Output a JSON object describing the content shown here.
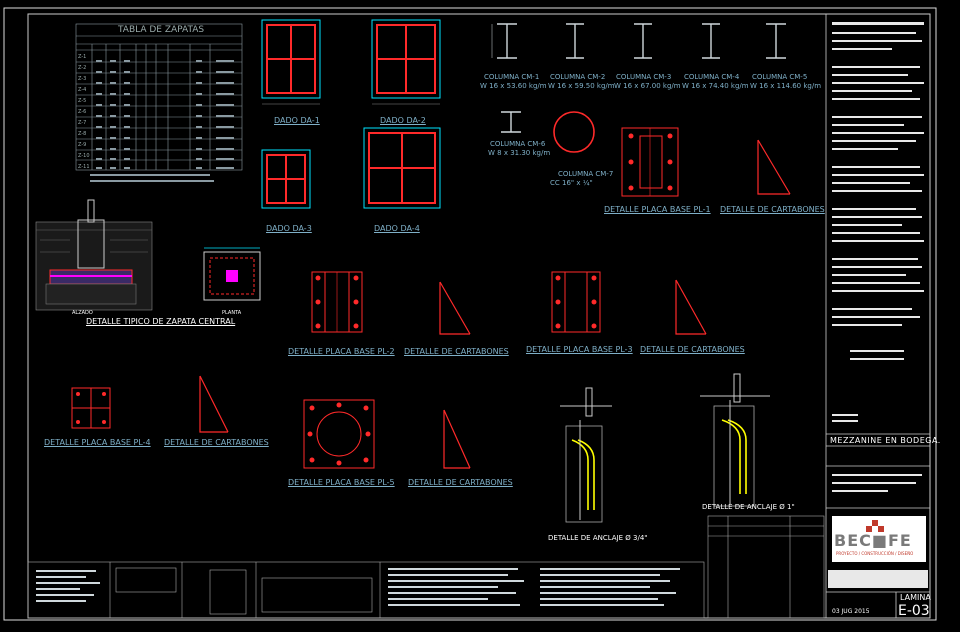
{
  "zapatas_table": {
    "title": "TABLA DE ZAPATAS",
    "rows": [
      "Z-1",
      "Z-2",
      "Z-3",
      "Z-4",
      "Z-5",
      "Z-6",
      "Z-7",
      "Z-8",
      "Z-9",
      "Z-10",
      "Z-11"
    ]
  },
  "dados": [
    "DADO DA-1",
    "DADO DA-2",
    "DADO DA-3",
    "DADO DA-4"
  ],
  "columnas": [
    "COLUMNA CM-1",
    "COLUMNA CM-2",
    "COLUMNA CM-3",
    "COLUMNA CM-4",
    "COLUMNA CM-5",
    "COLUMNA CM-6",
    "COLUMNA CM-7"
  ],
  "columnas_specs": [
    "W 16 x 53.60 kg/m",
    "W 16 x 59.50 kg/m",
    "W 16 x 67.00 kg/m",
    "W 16 x 74.40 kg/m",
    "W 16 x 114.60 kg/m",
    "W 8 x 31.30 kg/m",
    "CC 16\" x ¼\""
  ],
  "detalles": {
    "placa_pl1": "DETALLE PLACA BASE PL-1",
    "cartabones": "DETALLE DE CARTABONES",
    "zapata_central": "DETALLE TIPICO DE ZAPATA CENTRAL",
    "placa_pl2": "DETALLE PLACA BASE PL-2",
    "placa_pl3": "DETALLE PLACA BASE PL-3",
    "placa_pl4": "DETALLE PLACA BASE PL-4",
    "placa_pl5": "DETALLE PLACA BASE PL-5",
    "anclaje_34": "DETALLE DE ANCLAJE Ø 3/4\"",
    "anclaje_1": "DETALLE DE ANCLAJE Ø 1\""
  },
  "zapata_views": {
    "alzado": "ALZADO",
    "planta": "PLANTA"
  },
  "title_block": {
    "project": "MEZZANINE EN BODEGA.",
    "logo_name": "BEC■FE",
    "logo_sub": "PROYECTO / CONSTRUCCIÓN / DISEÑO",
    "lamina_label": "LAMINA",
    "lamina_code": "E-03",
    "date": "03 JUG 2015"
  },
  "colors": {
    "red": "#ff2a2a",
    "cyan": "#00e5ff",
    "yellow": "#ffff00",
    "magenta": "#ff00ff",
    "gray": "#9aa5ad"
  }
}
